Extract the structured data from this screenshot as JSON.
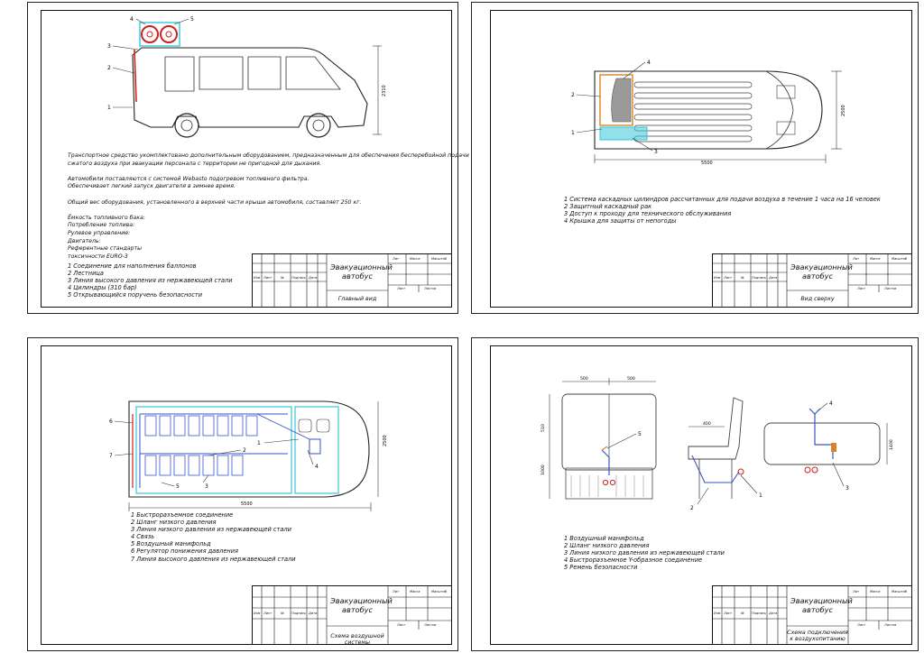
{
  "sheets": [
    {
      "id": "main-view",
      "notes": [
        "Транспортное средство укомплектовано дополнительным оборудованием, предназначенным для обеспечения бесперебойной подачи",
        "сжатого воздуха при эвакуации персонала с территории не пригодной для дыхания.",
        "",
        "Автомобили поставляются с системой Webasto подогревом топливного фильтра.",
        "Обеспечивает легкий запуск двигателя в зимнее время.",
        "",
        "Общий вес оборудования, установленного в верхней части крыши автомобиля, составляет 250 кг.",
        "",
        "Ёмкость топливного бака:",
        "Потребление топлива:",
        "Рулевое управление:",
        "Двигатель:",
        "Референтные стандарты",
        "токсичности                    EURO-3"
      ],
      "legend": [
        "1 Соединение для наполнения баллонов",
        "2 Лестница",
        "3 Линия высокого давления из нержавеющей стали",
        "4 Цилиндры (310 бар)",
        "5 Открывающийся поручень безопасности"
      ],
      "callouts": [
        "1",
        "2",
        "3",
        "4",
        "5"
      ],
      "dimension": "2310",
      "title": "Эвакуационный автобус",
      "sheet_name": "Главный вид"
    },
    {
      "id": "top-view",
      "legend": [
        "1 Система каскадных цилиндров рассчитанных для подачи воздуха в течение 1 часа на 16 человек",
        "2 Защитный каскадный рак",
        "3 Доступ к проходу для технического обслуживания",
        "4 Крышка для защиты от непогоды"
      ],
      "callouts": [
        "1",
        "2",
        "3",
        "4"
      ],
      "dimensions": [
        "5500",
        "2500"
      ],
      "title": "Эвакуационный автобус",
      "sheet_name": "Вид сверху"
    },
    {
      "id": "air-scheme",
      "legend": [
        "1 Быстроразъемное соединение",
        "2 Шланг низкого давления",
        "3 Линия низкого давления из нержавеющей стали",
        "4 Связь",
        "5 Воздушный манифольд",
        "6 Регулятор понижения давления",
        "7 Линия высокого давления из нержавеющей стали"
      ],
      "callouts": [
        "1",
        "2",
        "3",
        "4",
        "5",
        "6",
        "7"
      ],
      "dimensions": [
        "5500",
        "2500"
      ],
      "title": "Эвакуационный автобус",
      "sheet_name": "Схема воздушной системы"
    },
    {
      "id": "air-connection",
      "legend": [
        "1 Воздушный манифольд",
        "2 Шланг низкого давления",
        "3 Линия низкого давления из нержавеющей стали",
        "4 Быстроразъемное Y-образное соединение",
        "5 Ремень безопасности"
      ],
      "callouts": [
        "1",
        "2",
        "3",
        "4",
        "5"
      ],
      "dimensions": [
        "500",
        "500",
        "510",
        "1000",
        "400",
        "1400"
      ],
      "title": "Эвакуационный автобус",
      "sheet_name": "Схема подключения к воздухопитанию"
    }
  ],
  "title_block": {
    "headers": [
      "Изм",
      "Лист",
      "№",
      "Подпись",
      "Дата"
    ],
    "lit": "Лит",
    "mass": "Масса",
    "scale": "Масштаб",
    "list": "Лист",
    "lists": "Листов"
  },
  "colors": {
    "frame": "#111111",
    "cylinder_red": "#d02020",
    "air_blue": "#3a55c8",
    "tank_cyan": "#39c6d8",
    "cover_gray": "#9a9a9a",
    "rack_orange": "#d9822b"
  }
}
